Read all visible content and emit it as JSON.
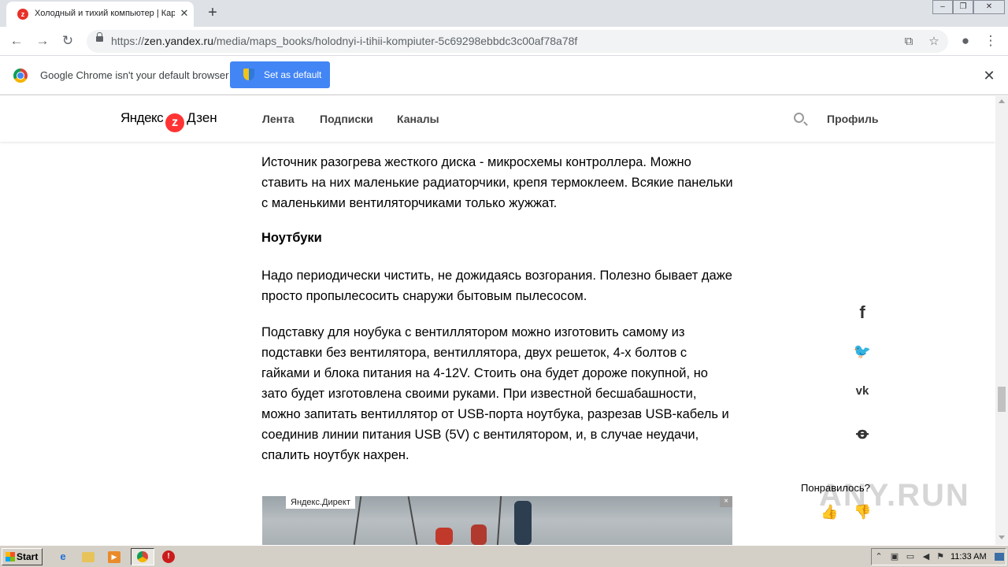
{
  "browser": {
    "tab_title": "Холодный и тихий компьютер | Кар",
    "tab_favicon_letter": "z",
    "url_prefix": "https://",
    "url_host": "zen.yandex.ru",
    "url_path": "/media/maps_books/holodnyi-i-tihii-kompiuter-5c69298ebbdc3c00af78a78f"
  },
  "infobar": {
    "message": "Google Chrome isn't your default browser",
    "button_label": "Set as default"
  },
  "zen": {
    "logo_left": "Яндекс",
    "logo_right": "Дзен",
    "nav": [
      "Лента",
      "Подписки",
      "Каналы"
    ],
    "profile": "Профиль"
  },
  "article": {
    "para1": "Источник разогрева жесткого диска - микросхемы контроллера. Можно ставить на них маленькие радиаторчики, крепя термоклеем. Всякие панельки с маленькими вентиляторчиками только жужжат.",
    "heading": "Ноутбуки",
    "para2": "Надо периодически чистить, не дожидаясь возгорания. Полезно бывает даже просто пропылесосить снаружи бытовым пылесосом.",
    "para3": "Подставку для ноубука с вентиллятором можно изготовить самому из подставки без вентилятора, вентиллятора, двух решеток, 4-х болтов с гайками и блока питания на 4-12V. Стоить она будет дороже покупной, но зато будет изготовлена своими руками. При известной бесшабашности, можно запитать вентиллятор от USB-порта ноутбука, разрезав USB-кабель и соединив линии питания USB (5V) с вентилятором, и, в случае неудачи, спалить ноутбук нахрен."
  },
  "ad": {
    "label": "Яндекс.Директ",
    "close": "×"
  },
  "sidebar": {
    "liked_question": "Понравилось?",
    "share_icons": [
      "facebook-icon",
      "twitter-icon",
      "vk-icon",
      "odnoklassniki-icon"
    ]
  },
  "watermark": "ANY.RUN",
  "taskbar": {
    "start_label": "Start",
    "clock": "11:33 AM"
  }
}
